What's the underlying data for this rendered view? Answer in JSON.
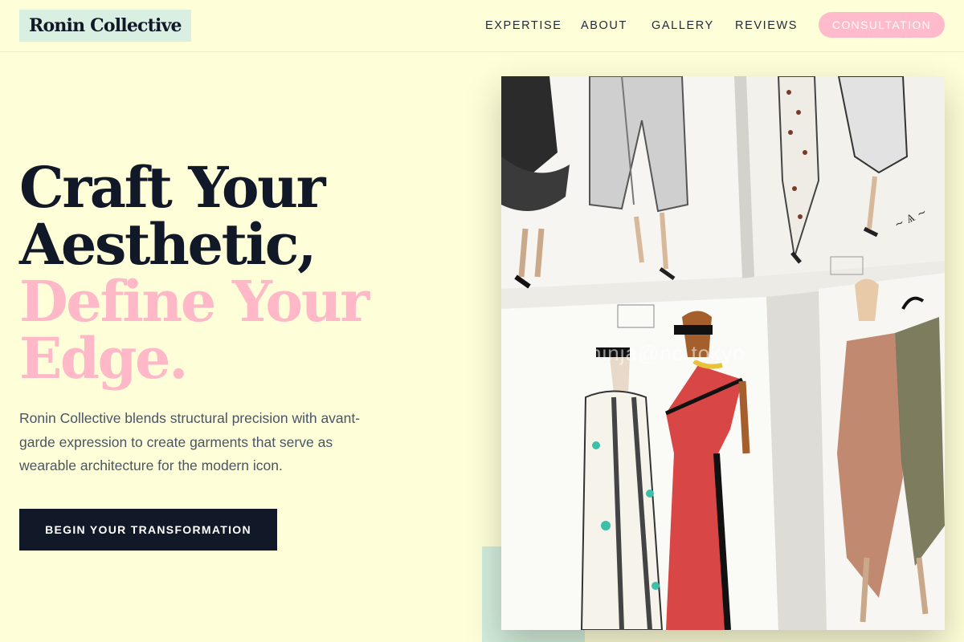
{
  "brand": {
    "name": "Ronin Collective"
  },
  "nav": {
    "links": [
      {
        "label": "EXPERTISE"
      },
      {
        "label": "ABOUT"
      },
      {
        "label": "GALLERY"
      },
      {
        "label": "REVIEWS"
      }
    ],
    "cta": "CONSULTATION"
  },
  "hero": {
    "title_line1": "Craft Your",
    "title_line2": "Aesthetic,",
    "title_line3": "Define Your",
    "title_line4": "Edge.",
    "description": "Ronin Collective blends structural precision with avant-garde expression to create garments that serve as wearable architecture for the modern icon.",
    "button": "BEGIN YOUR TRANSFORMATION",
    "image_watermark": "ninja@no.tokyo"
  },
  "colors": {
    "background": "#fefed9",
    "logo_bg": "#d9efe2",
    "accent_pink": "#ffb8c8",
    "dark": "#111827",
    "accent_mint": "#d2ecdc"
  },
  "icons": {
    "hero_image": "fashion-sketches-image"
  }
}
